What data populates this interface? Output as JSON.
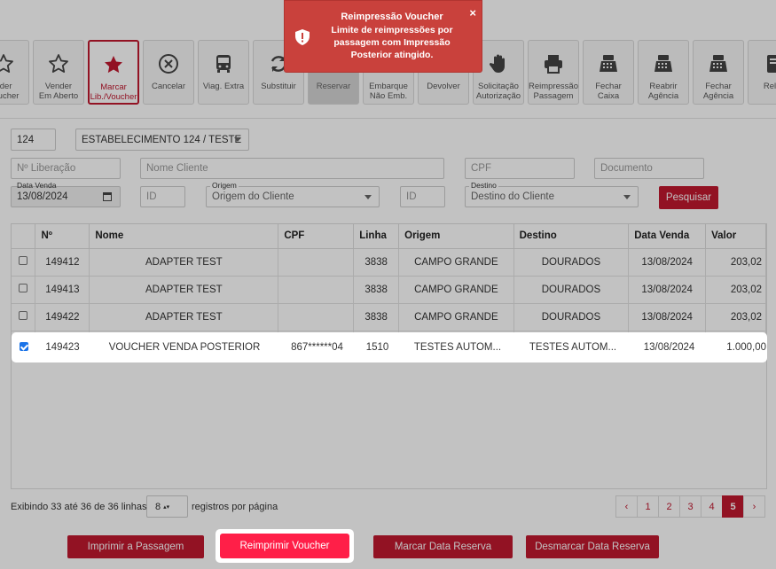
{
  "toolbar": [
    {
      "label": "nder\nVoucher",
      "icon": "star-outline-icon",
      "state": "normal"
    },
    {
      "label": "Vender\nEm Aberto",
      "icon": "star-outline-icon",
      "state": "normal"
    },
    {
      "label": "Marcar\nLib./Voucher",
      "icon": "star-filled-icon",
      "state": "active"
    },
    {
      "label": "Cancelar",
      "icon": "circle-x-icon",
      "state": "normal"
    },
    {
      "label": "Viag. Extra",
      "icon": "bus-icon",
      "state": "normal"
    },
    {
      "label": "Substituir",
      "icon": "refresh-icon",
      "state": "normal"
    },
    {
      "label": "Reservar",
      "icon": "unlock-icon",
      "state": "disabled"
    },
    {
      "label": "Embarque\nNão Emb.",
      "icon": "person-add-icon",
      "state": "normal"
    },
    {
      "label": "Devolver",
      "icon": "cart-icon",
      "state": "normal"
    },
    {
      "label": "Solicitação\nAutorização",
      "icon": "hand-icon",
      "state": "normal"
    },
    {
      "label": "Reimpressão\nPassagem",
      "icon": "printer-icon",
      "state": "normal"
    },
    {
      "label": "Fechar\nCaixa",
      "icon": "cash-register-icon",
      "state": "normal"
    },
    {
      "label": "Reabrir\nAgência",
      "icon": "cash-register-icon",
      "state": "normal"
    },
    {
      "label": "Fechar\nAgência",
      "icon": "cash-register-icon",
      "state": "normal"
    },
    {
      "label": "Relat",
      "icon": "report-icon",
      "state": "normal"
    }
  ],
  "filters": {
    "agency_code": "124",
    "establishment": "ESTABELECIMENTO 124 / TESTE",
    "liberacao_placeholder": "Nº Liberação",
    "nome_placeholder": "Nome Cliente",
    "cpf_placeholder": "CPF",
    "documento_placeholder": "Documento",
    "data_venda_label": "Data Venda",
    "data_venda_value": "13/08/2024",
    "id_placeholder": "ID",
    "origem_label": "Origem",
    "origem_value": "Origem do Cliente",
    "id2_placeholder": "ID",
    "destino_label": "Destino",
    "destino_value": "Destino do Cliente",
    "search_label": "Pesquisar"
  },
  "table": {
    "columns": [
      "",
      "Nº",
      "Nome",
      "CPF",
      "Linha",
      "Origem",
      "Destino",
      "Data Venda",
      "Valor"
    ],
    "rows": [
      {
        "checked": false,
        "n": "149412",
        "nome": "ADAPTER TEST",
        "cpf": "",
        "linha": "3838",
        "origem": "CAMPO GRANDE",
        "destino": "DOURADOS",
        "data": "13/08/2024",
        "valor": "203,02"
      },
      {
        "checked": false,
        "n": "149413",
        "nome": "ADAPTER TEST",
        "cpf": "",
        "linha": "3838",
        "origem": "CAMPO GRANDE",
        "destino": "DOURADOS",
        "data": "13/08/2024",
        "valor": "203,02"
      },
      {
        "checked": false,
        "n": "149422",
        "nome": "ADAPTER TEST",
        "cpf": "",
        "linha": "3838",
        "origem": "CAMPO GRANDE",
        "destino": "DOURADOS",
        "data": "13/08/2024",
        "valor": "203,02"
      }
    ],
    "highlighted_row": {
      "checked": true,
      "n": "149423",
      "nome": "VOUCHER VENDA POSTERIOR",
      "cpf": "867******04",
      "linha": "1510",
      "origem": "TESTES AUTOM...",
      "destino": "TESTES AUTOM...",
      "data": "13/08/2024",
      "valor": "1.000,00"
    }
  },
  "footer": {
    "info": "Exibindo 33 até 36 de 36 linhas",
    "per_page": "8",
    "per_page_label": "registros por página",
    "pages": [
      "‹",
      "1",
      "2",
      "3",
      "4",
      "5",
      "›"
    ],
    "current_page": "5"
  },
  "actions": {
    "imprimir": "Imprimir a Passagem",
    "reimprimir": "Reimprimir Voucher",
    "marcar": "Marcar Data Reserva",
    "desmarcar": "Desmarcar Data Reserva"
  },
  "toast": {
    "title": "Reimpressão Voucher",
    "message": "Limite de reimpressões por passagem com Impressão Posterior atingido.",
    "close": "×"
  },
  "colors": {
    "accent": "#c0182f",
    "highlight_button": "#ff1f48",
    "toast": "#c9413c"
  }
}
